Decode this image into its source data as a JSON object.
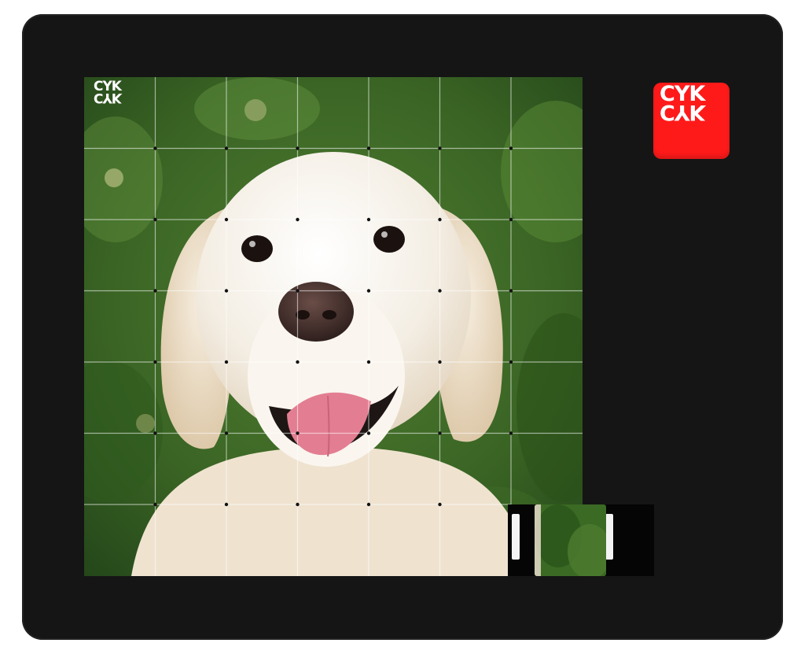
{
  "puzzle": {
    "brand_logo": "CYK",
    "grid_rows": 7,
    "grid_cols": 7,
    "image_subject": "golden-retriever",
    "empty_tile": {
      "row": 6,
      "col": 6
    },
    "colors": {
      "frame": "#151515",
      "badge": "#ff1a1a",
      "foliage": "#3d6b25",
      "dog_fur": "#f2ece2",
      "tongue": "#e37e92"
    }
  }
}
